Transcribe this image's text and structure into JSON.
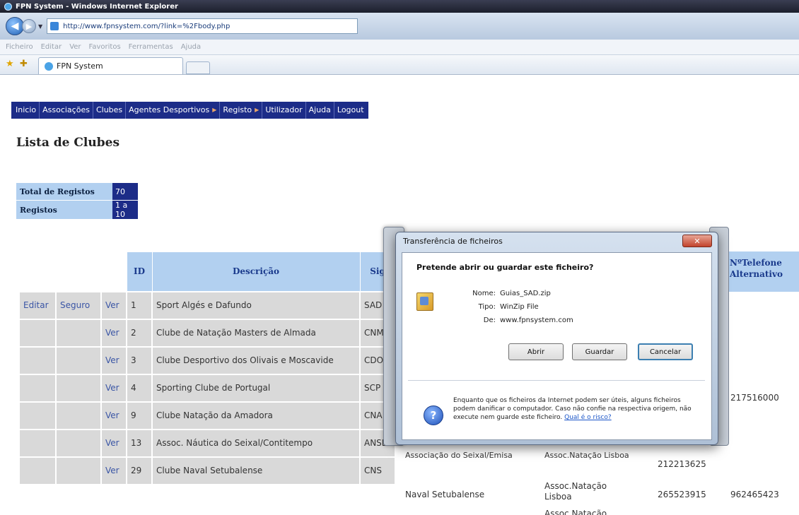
{
  "window": {
    "title": "FPN System - Windows Internet Explorer"
  },
  "address": {
    "url": "http://www.fpnsystem.com/?link=%2Fbody.php"
  },
  "menubar": {
    "items": [
      "Ficheiro",
      "Editar",
      "Ver",
      "Favoritos",
      "Ferramentas",
      "Ajuda"
    ]
  },
  "tab": {
    "title": "FPN System"
  },
  "sitemenu": {
    "items": [
      {
        "label": "Inicio"
      },
      {
        "label": "Associações"
      },
      {
        "label": "Clubes"
      },
      {
        "label": "Agentes Desportivos"
      },
      {
        "label": "Registo"
      },
      {
        "label": "Utilizador"
      },
      {
        "label": "Ajuda"
      },
      {
        "label": "Logout"
      }
    ]
  },
  "page": {
    "title": "Lista de Clubes"
  },
  "summary": {
    "total_label": "Total de Registos",
    "total_value": "70",
    "range_label": "Registos",
    "range_value": "1 a 10"
  },
  "table": {
    "headers": {
      "id": "ID",
      "descricao": "Descrição",
      "sigla": "Sig",
      "telefone_alt": "NºTelefone Alternativo"
    },
    "rows": [
      {
        "editar": "Editar",
        "seguro": "Seguro",
        "ver": "Ver",
        "id": "1",
        "descricao": "Sport Algés e Dafundo",
        "sigla": "SAD"
      },
      {
        "editar": "",
        "seguro": "",
        "ver": "Ver",
        "id": "2",
        "descricao": "Clube de Natação Masters de Almada",
        "sigla": "CNM"
      },
      {
        "editar": "",
        "seguro": "",
        "ver": "Ver",
        "id": "3",
        "descricao": "Clube Desportivo dos Olivais e Moscavide",
        "sigla": "CDO"
      },
      {
        "editar": "",
        "seguro": "",
        "ver": "Ver",
        "id": "4",
        "descricao": "Sporting Clube de Portugal",
        "sigla": "SCP"
      },
      {
        "editar": "",
        "seguro": "",
        "ver": "Ver",
        "id": "9",
        "descricao": "Clube Natação da Amadora",
        "sigla": "CNA"
      },
      {
        "editar": "",
        "seguro": "",
        "ver": "Ver",
        "id": "13",
        "descricao": "Assoc. Náutica do Seixal/Contitempo",
        "sigla": "ANSE"
      },
      {
        "editar": "",
        "seguro": "",
        "ver": "Ver",
        "id": "29",
        "descricao": "Clube Naval Setubalense",
        "sigla": "CNS"
      }
    ],
    "extra": {
      "row4_tel_alt": "217516000",
      "row6_nome": "Associação do Seixal/Emisa",
      "row6_assoc": "Assoc.Natação Lisboa",
      "row6_tel": "212213625",
      "row7_nome": "Naval Setubalense",
      "row7_assoc": "Assoc.Natação Lisboa",
      "row7_tel": "265523915",
      "row7_tel_alt": "962465423",
      "row8_assoc": "Assoc.Natação"
    }
  },
  "dialog": {
    "title": "Transferência de ficheiros",
    "question": "Pretende abrir ou guardar este ficheiro?",
    "name_label": "Nome:",
    "name_value": "Guias_SAD.zip",
    "type_label": "Tipo:",
    "type_value": "WinZip File",
    "from_label": "De:",
    "from_value": "www.fpnsystem.com",
    "open_button": "Abrir",
    "save_button": "Guardar",
    "cancel_button": "Cancelar",
    "warning": "Enquanto que os ficheiros da Internet podem ser úteis, alguns ficheiros podem danificar o computador. Caso não confie na respectiva origem, não execute nem guarde este ficheiro.",
    "risk_link": "Qual é o risco?"
  }
}
